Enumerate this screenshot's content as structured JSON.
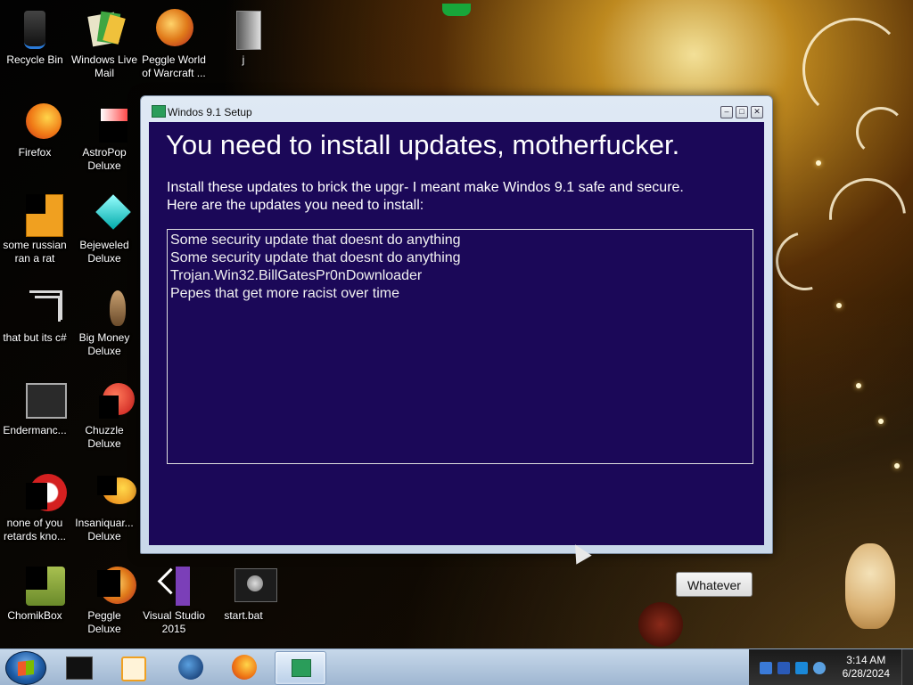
{
  "desktop": {
    "icons": [
      {
        "label": "Recycle Bin",
        "icon": "recycle-bin-icon"
      },
      {
        "label": "Windows Live Mail",
        "icon": "mail-icon"
      },
      {
        "label": "Peggle World of Warcraft ...",
        "icon": "peggle-icon"
      },
      {
        "label": "j",
        "icon": "folder-icon"
      },
      {
        "label": "Firefox",
        "icon": "firefox-icon"
      },
      {
        "label": "AstroPop Deluxe",
        "icon": "astropop-icon"
      },
      {
        "label": "some russian ran a rat",
        "icon": "rat-app-icon"
      },
      {
        "label": "Bejeweled Deluxe",
        "icon": "bejeweled-icon"
      },
      {
        "label": "that but its c#",
        "icon": "shortcut-icon"
      },
      {
        "label": "Big Money Deluxe",
        "icon": "big-money-icon"
      },
      {
        "label": "Endermanc...",
        "icon": "endermanch-icon"
      },
      {
        "label": "Chuzzle Deluxe",
        "icon": "chuzzle-icon"
      },
      {
        "label": "none of you retards kno...",
        "icon": "app-icon"
      },
      {
        "label": "Insaniquar... Deluxe",
        "icon": "insaniquarium-icon"
      },
      {
        "label": "ChomikBox",
        "icon": "chomikbox-icon"
      },
      {
        "label": "Peggle Deluxe",
        "icon": "peggle-deluxe-icon"
      },
      {
        "label": "Visual Studio 2015",
        "icon": "visual-studio-icon"
      },
      {
        "label": "start.bat",
        "icon": "batch-file-icon"
      }
    ]
  },
  "window": {
    "title": "Windos 9.1 Setup",
    "heading": "You need to install updates, motherfucker.",
    "intro_line1": "Install these updates to brick the upgr- I meant make Windos 9.1 safe and secure.",
    "intro_line2": "Here are the updates you need to install:",
    "updates": [
      "Some security update that doesnt do anything",
      "Some security update that doesnt do anything",
      "Trojan.Win32.BillGatesPr0nDownloader",
      "Pepes that get more racist over time"
    ],
    "button_label": "Whatever",
    "minimize_glyph": "‒",
    "maximize_glyph": "□",
    "close_glyph": "✕"
  },
  "taskbar": {
    "pinned": [
      "terminal-icon",
      "media-player-icon",
      "globe-icon",
      "firefox-icon",
      "setup-icon"
    ],
    "clock_time": "3:14 AM",
    "clock_date": "6/28/2024"
  },
  "colors": {
    "client_bg": "#1b0858",
    "taskbar": "#b3c7de"
  }
}
